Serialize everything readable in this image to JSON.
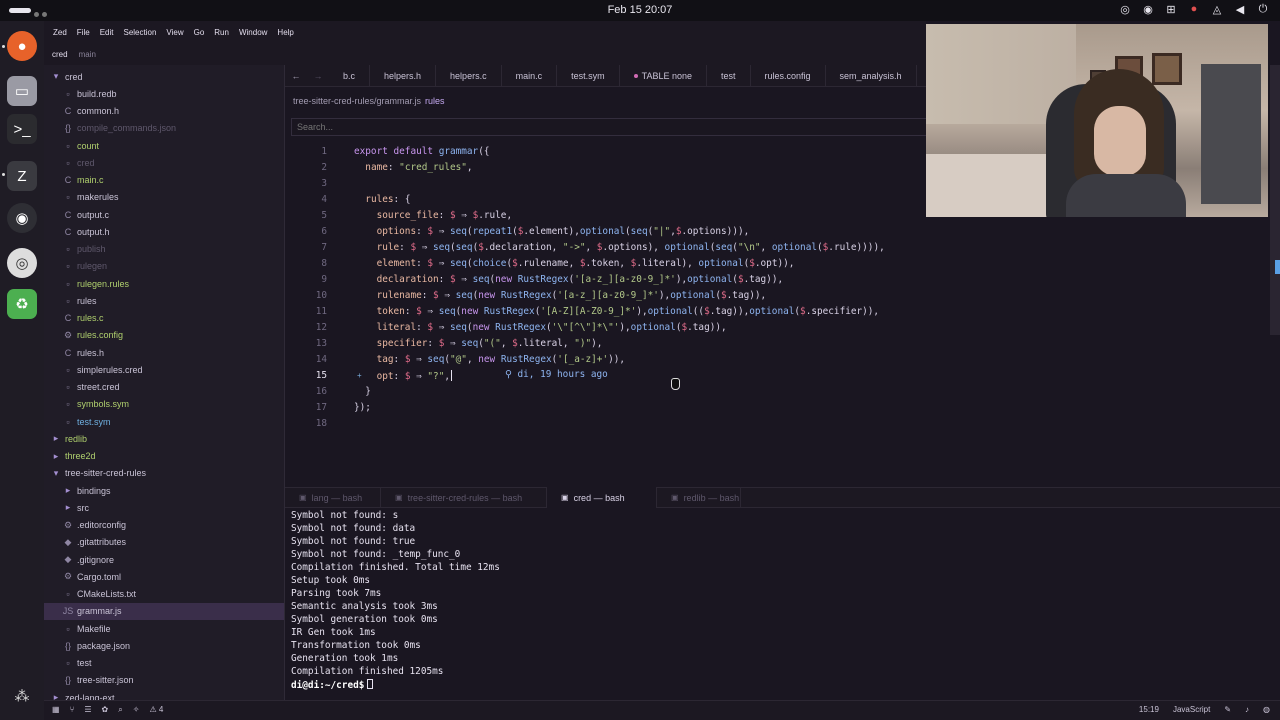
{
  "topbar": {
    "clock": "Feb 15  20:07"
  },
  "menu": [
    "Zed",
    "File",
    "Edit",
    "Selection",
    "View",
    "Go",
    "Run",
    "Window",
    "Help"
  ],
  "branchbar": {
    "project": "cred",
    "branch": "main"
  },
  "project_panel": {
    "rows": [
      {
        "label": "cred",
        "type": "folder-open",
        "depth": 0,
        "status": "normal"
      },
      {
        "label": "build.redb",
        "type": "file",
        "depth": 1,
        "status": "normal"
      },
      {
        "label": "common.h",
        "type": "c",
        "depth": 1,
        "status": "normal"
      },
      {
        "label": "compile_commands.json",
        "type": "json",
        "depth": 1,
        "status": "dim"
      },
      {
        "label": "count",
        "type": "file",
        "depth": 1,
        "status": "modified"
      },
      {
        "label": "cred",
        "type": "file",
        "depth": 1,
        "status": "dim"
      },
      {
        "label": "main.c",
        "type": "c",
        "depth": 1,
        "status": "modified"
      },
      {
        "label": "makerules",
        "type": "file",
        "depth": 1,
        "status": "normal"
      },
      {
        "label": "output.c",
        "type": "c",
        "depth": 1,
        "status": "normal"
      },
      {
        "label": "output.h",
        "type": "c",
        "depth": 1,
        "status": "normal"
      },
      {
        "label": "publish",
        "type": "file",
        "depth": 1,
        "status": "dim"
      },
      {
        "label": "rulegen",
        "type": "file",
        "depth": 1,
        "status": "dim"
      },
      {
        "label": "rulegen.rules",
        "type": "file",
        "depth": 1,
        "status": "modified"
      },
      {
        "label": "rules",
        "type": "file",
        "depth": 1,
        "status": "normal"
      },
      {
        "label": "rules.c",
        "type": "c",
        "depth": 1,
        "status": "modified"
      },
      {
        "label": "rules.config",
        "type": "gear",
        "depth": 1,
        "status": "modified"
      },
      {
        "label": "rules.h",
        "type": "c",
        "depth": 1,
        "status": "normal"
      },
      {
        "label": "simplerules.cred",
        "type": "file",
        "depth": 1,
        "status": "normal"
      },
      {
        "label": "street.cred",
        "type": "file",
        "depth": 1,
        "status": "normal"
      },
      {
        "label": "symbols.sym",
        "type": "file",
        "depth": 1,
        "status": "modified"
      },
      {
        "label": "test.sym",
        "type": "file",
        "depth": 1,
        "status": "added"
      },
      {
        "label": "redlib",
        "type": "folder",
        "depth": 0,
        "status": "modified"
      },
      {
        "label": "three2d",
        "type": "folder",
        "depth": 0,
        "status": "modified"
      },
      {
        "label": "tree-sitter-cred-rules",
        "type": "folder-open",
        "depth": 0,
        "status": "normal"
      },
      {
        "label": "bindings",
        "type": "folder",
        "depth": 1,
        "status": "normal"
      },
      {
        "label": "src",
        "type": "folder",
        "depth": 1,
        "status": "normal"
      },
      {
        "label": ".editorconfig",
        "type": "gear",
        "depth": 1,
        "status": "normal"
      },
      {
        "label": ".gitattributes",
        "type": "git",
        "depth": 1,
        "status": "normal"
      },
      {
        "label": ".gitignore",
        "type": "git",
        "depth": 1,
        "status": "normal"
      },
      {
        "label": "Cargo.toml",
        "type": "toml",
        "depth": 1,
        "status": "normal"
      },
      {
        "label": "CMakeLists.txt",
        "type": "file",
        "depth": 1,
        "status": "normal"
      },
      {
        "label": "grammar.js",
        "type": "js",
        "depth": 1,
        "status": "selected"
      },
      {
        "label": "Makefile",
        "type": "file",
        "depth": 1,
        "status": "normal"
      },
      {
        "label": "package.json",
        "type": "json",
        "depth": 1,
        "status": "normal"
      },
      {
        "label": "test",
        "type": "file",
        "depth": 1,
        "status": "normal"
      },
      {
        "label": "tree-sitter.json",
        "type": "json",
        "depth": 1,
        "status": "normal"
      },
      {
        "label": "zed-lang-ext",
        "type": "folder",
        "depth": 0,
        "status": "normal"
      }
    ]
  },
  "tabs": [
    {
      "label": "b.c",
      "modified": false
    },
    {
      "label": "helpers.h",
      "modified": false
    },
    {
      "label": "helpers.c",
      "modified": false
    },
    {
      "label": "main.c",
      "modified": false
    },
    {
      "label": "test.sym",
      "modified": false
    },
    {
      "label": "TABLE none",
      "modified": true
    },
    {
      "label": "test",
      "modified": false
    },
    {
      "label": "rules.config",
      "modified": false
    },
    {
      "label": "sem_analysis.h",
      "modified": false
    }
  ],
  "breadcrumb": {
    "path": "tree-sitter-cred-rules/grammar.js",
    "symbol": "rules"
  },
  "search": {
    "placeholder": "Search..."
  },
  "editor": {
    "current_line": 15,
    "blame": "di, 19 hours ago",
    "lines": [
      "1",
      "2",
      "3",
      "4",
      "5",
      "6",
      "7",
      "8",
      "9",
      "10",
      "11",
      "12",
      "13",
      "14",
      "15",
      "16",
      "17",
      "18"
    ]
  },
  "terminal_tabs": [
    {
      "label": "lang — bash",
      "active": false
    },
    {
      "label": "tree-sitter-cred-rules — bash",
      "active": false
    },
    {
      "label": "cred — bash",
      "active": true
    },
    {
      "label": "redlib — bash",
      "active": false
    }
  ],
  "terminal": {
    "lines": [
      "Symbol not found: s",
      "Symbol not found: data",
      "Symbol not found: true",
      "Symbol not found: _temp_func_0",
      "Compilation finished. Total time 12ms",
      "Setup took 0ms",
      "Parsing took 7ms",
      "Semantic analysis took 3ms",
      "Symbol generation took 0ms",
      "IR Gen took 1ms",
      "Transformation took 0ms",
      "Generation took 1ms",
      "Compilation finished 1205ms"
    ],
    "prompt": "di@di:~/cred$"
  },
  "statusbar": {
    "warnings": "4",
    "cursor_position": "15:19",
    "language": "JavaScript"
  }
}
